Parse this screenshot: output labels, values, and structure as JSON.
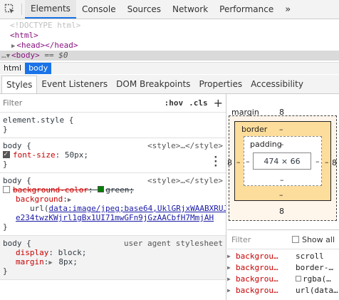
{
  "toolbar": {
    "tabs": [
      "Elements",
      "Console",
      "Sources",
      "Network",
      "Performance"
    ],
    "more": "»"
  },
  "dom": {
    "doctype": "<!DOCTYPE html>",
    "html_open": "<html>",
    "head": "<head></head>",
    "body": "<body>",
    "body_suffix": " == $0"
  },
  "breadcrumbs": [
    "html",
    "body"
  ],
  "subtabs": [
    "Styles",
    "Event Listeners",
    "DOM Breakpoints",
    "Properties",
    "Accessibility"
  ],
  "styles": {
    "filter_placeholder": "Filter",
    "hov": ":hov",
    "cls": ".cls",
    "plus": "+",
    "element_style": "element.style {",
    "close": "}",
    "rules": [
      {
        "selector": "body {",
        "origin": "<style>…</style>",
        "props": [
          {
            "name": "font-size",
            "value": "50px;"
          }
        ]
      },
      {
        "selector": "body {",
        "origin": "<style>…</style>",
        "struck_name": "background-color",
        "struck_value": "green;",
        "bg_name": "background",
        "url_prefix": "url(",
        "url_text_1": "data:image/jpeg;base64,UklGRjxWAABXRUJ",
        "url_text_2": "e234twzKWjrl1gBx1UI71mwGFn9jGzAACbfH7MmjAH"
      },
      {
        "selector": "body {",
        "origin": "user agent stylesheet",
        "props": [
          {
            "name": "display",
            "value": "block;"
          },
          {
            "name": "margin",
            "value": "8px;"
          }
        ]
      }
    ]
  },
  "boxmodel": {
    "margin_label": "margin",
    "margin_top": "8",
    "margin_left": "8",
    "margin_right": "8",
    "margin_bottom": "8",
    "border_label": "border",
    "border_top": "–",
    "border_left": "–",
    "border_right": "–",
    "border_bottom": "–",
    "padding_label": "padding",
    "padding_top": "–",
    "padding_left": "–",
    "padding_right": "–",
    "padding_bottom": "–",
    "content": "474 × 66"
  },
  "computed": {
    "filter_placeholder": "Filter",
    "show_all": "Show all",
    "rows": [
      {
        "name": "backgrou…",
        "value": "scroll"
      },
      {
        "name": "backgrou…",
        "value": "border-…"
      },
      {
        "name": "backgrou…",
        "value": "rgba(…"
      },
      {
        "name": "backgrou…",
        "value": "url(data…"
      }
    ]
  }
}
